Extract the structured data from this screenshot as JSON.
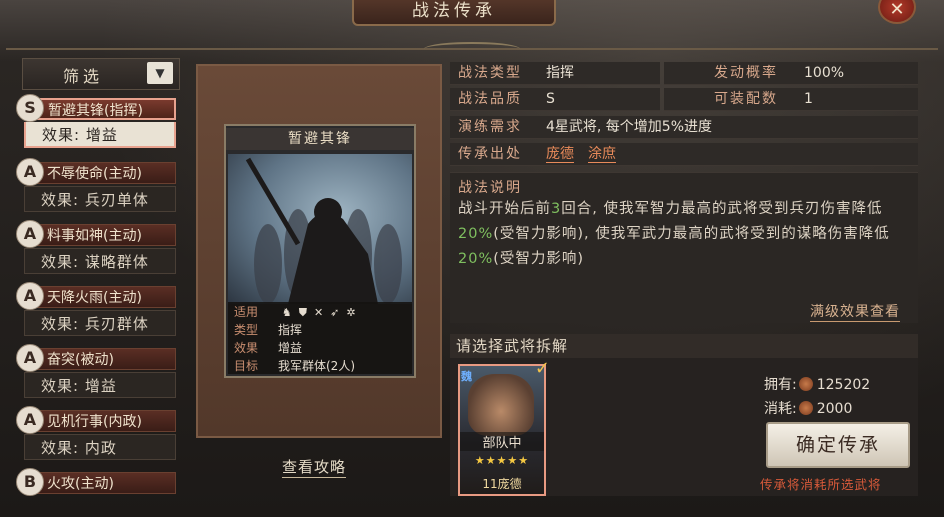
{
  "window": {
    "title": "战法传承",
    "close": "✕"
  },
  "filter": {
    "label": "筛选",
    "icon": "caret-down-icon"
  },
  "skills": [
    {
      "grade": "S",
      "name": "暂避其锋(指挥)",
      "effect": "效果: 增益",
      "selected": true
    },
    {
      "grade": "A",
      "name": "不辱使命(主动)",
      "effect": "效果: 兵刃单体"
    },
    {
      "grade": "A",
      "name": "料事如神(主动)",
      "effect": "效果: 谋略群体"
    },
    {
      "grade": "A",
      "name": "天降火雨(主动)",
      "effect": "效果: 兵刃群体"
    },
    {
      "grade": "A",
      "name": "奋突(被动)",
      "effect": "效果: 增益"
    },
    {
      "grade": "A",
      "name": "见机行事(内政)",
      "effect": "效果: 内政"
    },
    {
      "grade": "B",
      "name": "火攻(主动)",
      "effect": ""
    }
  ],
  "card": {
    "title": "暂避其锋",
    "rows": [
      {
        "k": "适用",
        "v": ""
      },
      {
        "k": "类型",
        "v": "指挥"
      },
      {
        "k": "效果",
        "v": "增益"
      },
      {
        "k": "目标",
        "v": "我军群体(2人)"
      }
    ]
  },
  "guide_link": "查看攻略",
  "info": {
    "type_label": "战法类型",
    "type_value": "指挥",
    "rate_label": "发动概率",
    "rate_value": "100%",
    "quality_label": "战法品质",
    "quality_value": "S",
    "equip_label": "可装配数",
    "equip_value": "1",
    "req_label": "演练需求",
    "req_value": "4星武将, 每个增加5%进度",
    "source_label": "传承出处",
    "sources": [
      "庞德",
      "涂庶"
    ]
  },
  "description": {
    "title": "战法说明",
    "p1": "战斗开始后前",
    "n1": "3",
    "p2": "回合, 使我军智力最高的武将受到兵刃伤害降低",
    "n2": "20%",
    "p3": "(受智力影响), 使我军武力最高的武将受到的谋略伤害降低",
    "n3": "20%",
    "p4": "(受智力影响)",
    "full_effect_link": "满级效果查看"
  },
  "choose": {
    "title": "请选择武将拆解",
    "general": {
      "faction": "魏",
      "unit": "部队中",
      "stars": "★★★★★",
      "name": "11庞德"
    },
    "owned_label": "拥有:",
    "owned_value": "125202",
    "cost_label": "消耗:",
    "cost_value": "2000",
    "confirm": "确定传承",
    "warning": "传承将消耗所选武将"
  },
  "colors": {
    "accent": "#e88a5a",
    "highlight": "#7fbf5f",
    "warning": "#d85a3a"
  }
}
